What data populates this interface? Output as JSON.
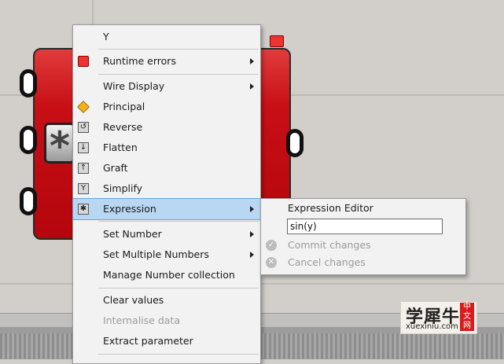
{
  "main_menu": {
    "items": [
      {
        "label": "Y"
      },
      {
        "label": "Runtime errors",
        "icon": "error-balloon-icon"
      },
      {
        "label": "Wire Display"
      },
      {
        "label": "Principal",
        "icon": "principal-diamond-icon"
      },
      {
        "label": "Reverse",
        "icon": "reverse-icon"
      },
      {
        "label": "Flatten",
        "icon": "flatten-icon"
      },
      {
        "label": "Graft",
        "icon": "graft-icon"
      },
      {
        "label": "Simplify",
        "icon": "simplify-icon"
      },
      {
        "label": "Expression",
        "icon": "expression-icon"
      },
      {
        "label": "Set Number"
      },
      {
        "label": "Set Multiple Numbers"
      },
      {
        "label": "Manage Number collection"
      },
      {
        "label": "Clear values"
      },
      {
        "label": "Internalise data"
      },
      {
        "label": "Extract parameter"
      }
    ]
  },
  "expression_menu": {
    "title": "Expression Editor",
    "input_value": "sin(y)",
    "commit_label": "Commit changes",
    "cancel_label": "Cancel changes"
  },
  "watermark": {
    "title": "学犀牛",
    "url": "xuexiniu.com",
    "badge": "中文网"
  },
  "colors": {
    "node_red": "#c80f16",
    "highlight": "#b9d7f2",
    "menu_bg": "#f2f2f2",
    "canvas": "#d2cfca"
  }
}
